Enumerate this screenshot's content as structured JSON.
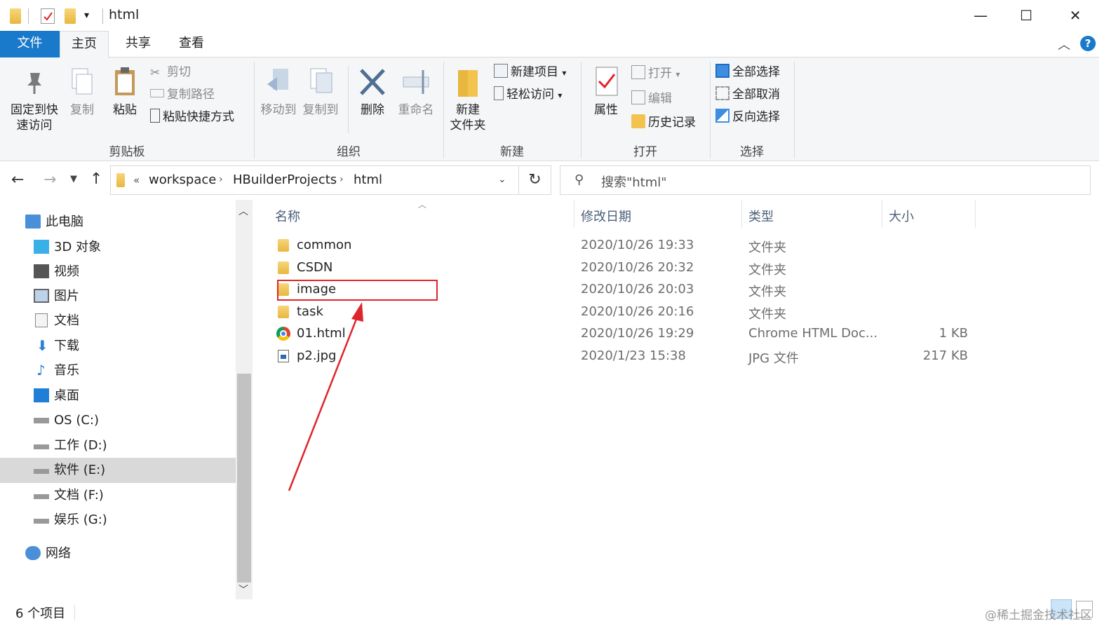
{
  "window": {
    "title": "html"
  },
  "titlebar": {
    "minimize": "—",
    "maximize": "☐",
    "close": "✕"
  },
  "tabs": [
    {
      "label": "文件"
    },
    {
      "label": "主页"
    },
    {
      "label": "共享"
    },
    {
      "label": "查看"
    }
  ],
  "help": "?",
  "ribbon": {
    "clipboard": {
      "pin": "固定到快\n速访问",
      "copy": "复制",
      "paste": "粘贴",
      "cut": "剪切",
      "copy_path": "复制路径",
      "paste_shortcut": "粘贴快捷方式",
      "label": "剪贴板"
    },
    "organize": {
      "move_to": "移动到",
      "copy_to": "复制到",
      "delete": "删除",
      "rename": "重命名",
      "label": "组织"
    },
    "new": {
      "new_folder": "新建\n文件夹",
      "new_item": "新建项目",
      "easy_access": "轻松访问",
      "label": "新建"
    },
    "open": {
      "properties": "属性",
      "open": "打开",
      "edit": "编辑",
      "history": "历史记录",
      "label": "打开"
    },
    "select": {
      "select_all": "全部选择",
      "select_none": "全部取消",
      "invert": "反向选择",
      "label": "选择"
    }
  },
  "address": {
    "overflow": "«",
    "crumbs": [
      "workspace",
      "HBuilderProjects",
      "html"
    ],
    "search_placeholder": "搜索\"html\""
  },
  "navpane": [
    {
      "label": "此电脑",
      "icon": "computer-icon"
    },
    {
      "label": "3D 对象",
      "icon": "cube-icon"
    },
    {
      "label": "视频",
      "icon": "video-icon"
    },
    {
      "label": "图片",
      "icon": "picture-icon"
    },
    {
      "label": "文档",
      "icon": "document-icon"
    },
    {
      "label": "下载",
      "icon": "download-icon"
    },
    {
      "label": "音乐",
      "icon": "music-icon"
    },
    {
      "label": "桌面",
      "icon": "desktop-icon"
    },
    {
      "label": "OS (C:)",
      "icon": "windows-drive-icon"
    },
    {
      "label": "工作 (D:)",
      "icon": "drive-icon"
    },
    {
      "label": "软件 (E:)",
      "icon": "drive-icon",
      "selected": true
    },
    {
      "label": "文档 (F:)",
      "icon": "drive-icon"
    },
    {
      "label": "娱乐 (G:)",
      "icon": "drive-icon"
    },
    {
      "label": "网络",
      "icon": "network-icon"
    }
  ],
  "columns": {
    "name": "名称",
    "modified": "修改日期",
    "type": "类型",
    "size": "大小"
  },
  "files": [
    {
      "name": "common",
      "modified": "2020/10/26 19:33",
      "type": "文件夹",
      "size": "",
      "icon": "folder-icon"
    },
    {
      "name": "CSDN",
      "modified": "2020/10/26 20:32",
      "type": "文件夹",
      "size": "",
      "icon": "folder-icon"
    },
    {
      "name": "image",
      "modified": "2020/10/26 20:03",
      "type": "文件夹",
      "size": "",
      "icon": "folder-icon",
      "highlighted": true
    },
    {
      "name": "task",
      "modified": "2020/10/26 20:16",
      "type": "文件夹",
      "size": "",
      "icon": "folder-icon"
    },
    {
      "name": "01.html",
      "modified": "2020/10/26 19:29",
      "type": "Chrome HTML Doc...",
      "size": "1 KB",
      "icon": "chrome-icon"
    },
    {
      "name": "p2.jpg",
      "modified": "2020/1/23 15:38",
      "type": "JPG 文件",
      "size": "217 KB",
      "icon": "image-file-icon"
    }
  ],
  "status": {
    "count": "6 个项目"
  },
  "watermark": "@稀土掘金技术社区",
  "colors": {
    "accent": "#1979ca",
    "highlight_box": "#e0242b",
    "arrow": "#e0242b",
    "selected_nav": "#d9d9d9"
  }
}
